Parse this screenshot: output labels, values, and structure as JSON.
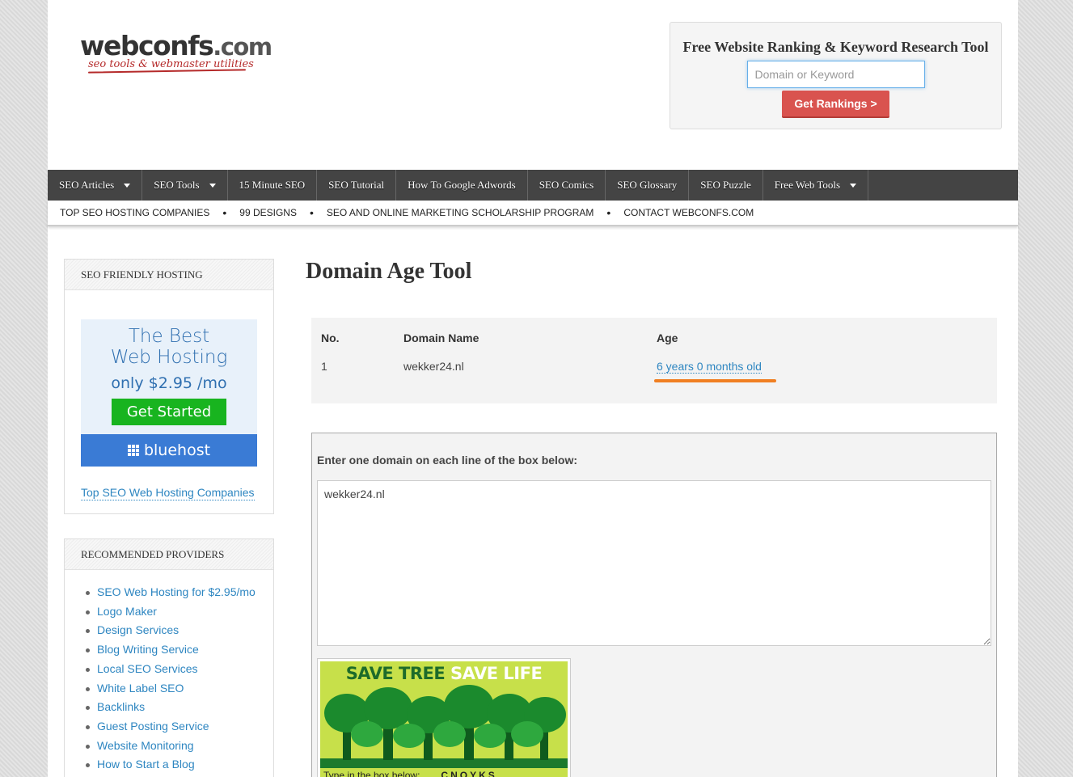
{
  "logo": {
    "name": "webconfs",
    "tld": ".com",
    "tagline": "seo tools & webmaster utilities"
  },
  "ranking": {
    "title": "Free Website Ranking & Keyword Research Tool",
    "input_placeholder": "Domain or Keyword",
    "button_label": "Get Rankings >"
  },
  "nav": {
    "items": [
      {
        "label": "SEO Articles",
        "has_dropdown": true
      },
      {
        "label": "SEO Tools",
        "has_dropdown": true
      },
      {
        "label": "15 Minute SEO",
        "has_dropdown": false
      },
      {
        "label": "SEO Tutorial",
        "has_dropdown": false
      },
      {
        "label": "How To Google Adwords",
        "has_dropdown": false
      },
      {
        "label": "SEO Comics",
        "has_dropdown": false
      },
      {
        "label": "SEO Glossary",
        "has_dropdown": false
      },
      {
        "label": "SEO Puzzle",
        "has_dropdown": false
      },
      {
        "label": "Free Web Tools",
        "has_dropdown": true
      }
    ]
  },
  "subnav": {
    "items": [
      "TOP SEO HOSTING COMPANIES",
      "99 DESIGNS",
      "SEO AND ONLINE MARKETING SCHOLARSHIP PROGRAM",
      "CONTACT WEBCONFS.COM"
    ]
  },
  "sidebar": {
    "hosting": {
      "title": "SEO FRIENDLY HOSTING",
      "ad": {
        "line1": "The Best",
        "line2": "Web Hosting",
        "line3": "only  $2.95 /mo",
        "button": "Get Started",
        "brand": "bluehost"
      },
      "link": "Top SEO Web Hosting Companies"
    },
    "providers": {
      "title": "RECOMMENDED PROVIDERS",
      "items": [
        "SEO Web Hosting for $2.95/mo",
        "Logo Maker",
        "Design Services",
        "Blog Writing Service",
        "Local SEO Services",
        "White Label SEO",
        "Backlinks",
        "Guest Posting Service",
        "Website Monitoring",
        "How to Start a Blog"
      ]
    }
  },
  "main": {
    "title": "Domain Age Tool",
    "results": {
      "headers": {
        "no": "No.",
        "domain": "Domain Name",
        "age": "Age"
      },
      "rows": [
        {
          "no": "1",
          "domain": "wekker24.nl",
          "age": "6 years 0 months old"
        }
      ]
    },
    "form": {
      "label": "Enter one domain on each line of the box below:",
      "textarea_value": "wekker24.nl",
      "captcha": {
        "title_a": "SAVE TREE",
        "title_b": "SAVE LIFE",
        "prompt": "Type in the box below:",
        "code": "CNOYKS"
      }
    }
  },
  "colors": {
    "nav_bg": "#444444",
    "link": "#2e86c1",
    "button_red": "#d9534f",
    "highlight": "#f07f22"
  }
}
